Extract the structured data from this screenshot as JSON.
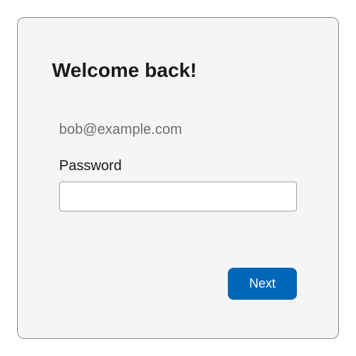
{
  "login": {
    "title": "Welcome back!",
    "email": "bob@example.com",
    "password_label": "Password",
    "password_value": "",
    "next_label": "Next"
  }
}
